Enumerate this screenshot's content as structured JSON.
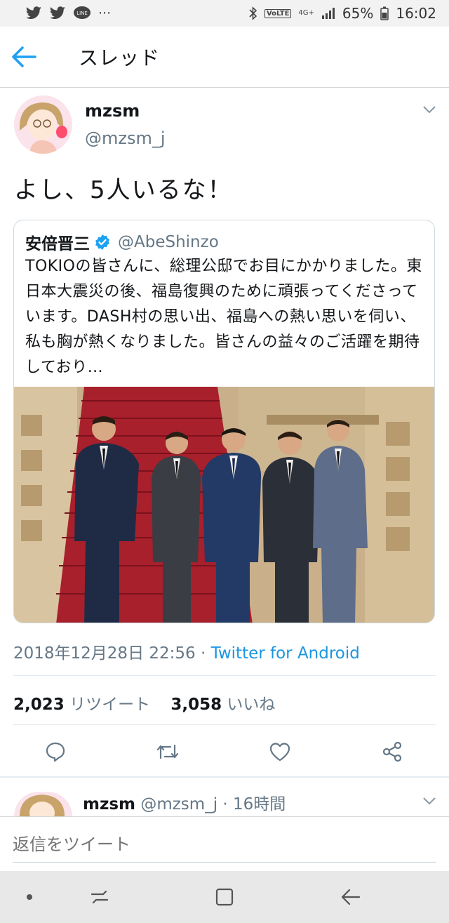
{
  "status_bar": {
    "left_icons": [
      "twitter-icon",
      "twitter-icon",
      "line-icon",
      "more-dots-icon"
    ],
    "line_label": "LINE",
    "dots": "···",
    "volte": "VoLTE",
    "network": "4G+",
    "battery": "65%",
    "time": "16:02"
  },
  "app_bar": {
    "title": "スレッド"
  },
  "tweet": {
    "name": "mzsm",
    "handle": "@mzsm_j",
    "text": "よし、5人いるな！",
    "quoted": {
      "name": "安倍晋三",
      "handle": "@AbeShinzo",
      "text": "TOKIOの皆さんに、総理公邸でお目にかかりました。東日本大震災の後、福島復興のために頑張ってくださっています。DASH村の思い出、福島への熱い思いを伺い、私も胸が熱くなりました。皆さんの益々のご活躍を期待しており…",
      "image": "photo-five-men-in-suits-on-red-staircase"
    },
    "date": "2018年12月28日 22:56",
    "separator": " · ",
    "source": "Twitter for Android",
    "retweets_count": "2,023",
    "retweets_label": "リツイート",
    "likes_count": "3,058",
    "likes_label": "いいね"
  },
  "reply": {
    "name": "mzsm",
    "handle": "@mzsm_j",
    "time": "· 16時間"
  },
  "compose": {
    "placeholder": "返信をツイート"
  },
  "colors": {
    "accent": "#1da1f2",
    "link": "#1b95e0",
    "muted": "#657786"
  }
}
